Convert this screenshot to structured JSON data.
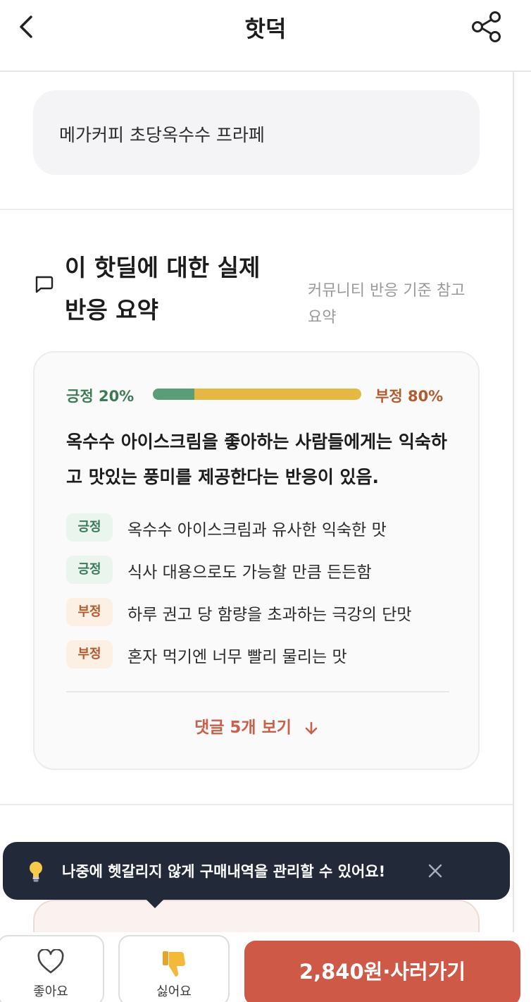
{
  "header": {
    "title": "핫덕",
    "back_icon": "chevron-left-icon",
    "share_icon": "share-icon"
  },
  "product": {
    "name": "메가커피 초당옥수수 프라페"
  },
  "summary": {
    "title": "이 핫딜에 대한 실제 반응 요약",
    "subtitle": "커뮤니티 반응 기준 참고 요약",
    "icon": "chat-bubble-icon",
    "positive_label": "긍정 20%",
    "negative_label": "부정 80%",
    "positive_share": 0.2,
    "headline": "옥수수 아이스크림을 좋아하는 사람들에게는 익숙하고 맛있는 풍미를 제공한다는 반응이 있음.",
    "points": [
      {
        "tag": "긍정",
        "text": "옥수수 아이스크림과 유사한 익숙한 맛"
      },
      {
        "tag": "긍정",
        "text": "식사 대용으로도 가능할 만큼 든든함"
      },
      {
        "tag": "부정",
        "text": "하루 권고 당 함량을 초과하는 극강의 단맛"
      },
      {
        "tag": "부정",
        "text": "혼자 먹기엔 너무 빨리 물리는 맛"
      }
    ],
    "comments_link": "댓글 5개 보기"
  },
  "toast": {
    "icon": "lightbulb-icon",
    "text": "나중에 헷갈리지 않게 구매내역을 관리할 수 있어요!"
  },
  "bottom": {
    "like_label": "좋아요",
    "dislike_label": "싫어요",
    "buy_label": "2,840원·사러가기"
  },
  "colors": {
    "positive": "#3d7a56",
    "negative": "#b55a2e",
    "accent": "#cf5947",
    "toast_bg": "#222a3a"
  }
}
